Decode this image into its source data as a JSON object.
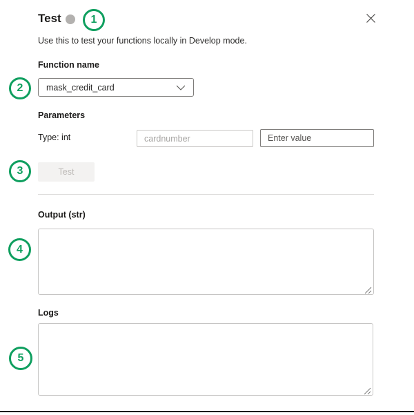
{
  "panel": {
    "title": "Test",
    "subtitle": "Use this to test your functions locally in Develop mode."
  },
  "function_name": {
    "label": "Function name",
    "selected_value": "mask_credit_card"
  },
  "parameters": {
    "label": "Parameters",
    "rows": [
      {
        "type_label": "Type: int",
        "name_placeholder": "cardnumber",
        "value_placeholder": "Enter value"
      }
    ]
  },
  "actions": {
    "test_label": "Test"
  },
  "output": {
    "label": "Output (str)",
    "value": ""
  },
  "logs": {
    "label": "Logs",
    "value": ""
  },
  "annotations": {
    "step1": "1",
    "step2": "2",
    "step3": "3",
    "step4": "4",
    "step5": "5"
  },
  "icons": {
    "close_icon": "✕",
    "chevron_down_icon": "⌄",
    "resize_handle_icon": "⟋"
  },
  "colors": {
    "annotation_green": "#0f9f5f",
    "status_dot_gray": "#b3b1af",
    "disabled_button_bg": "#f3f2f1",
    "bottom_border": "#010101"
  }
}
